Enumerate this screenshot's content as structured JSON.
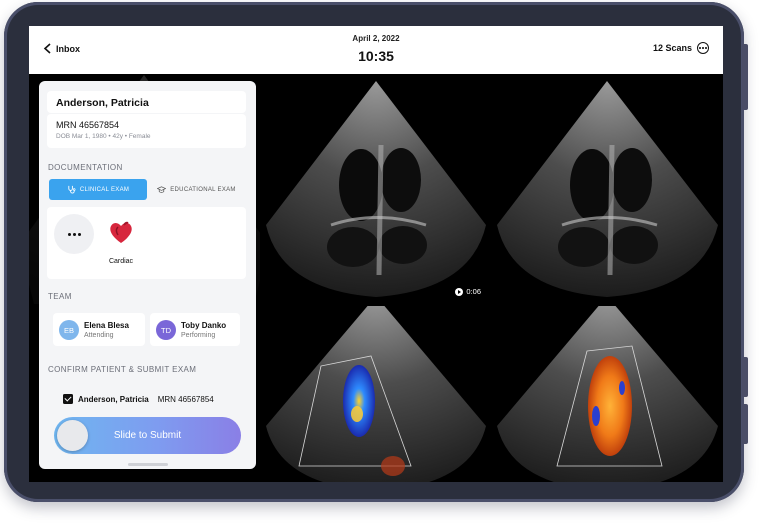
{
  "header": {
    "back_label": "Inbox",
    "date": "April 2, 2022",
    "time": "10:35",
    "scans_label": "12 Scans"
  },
  "patient": {
    "name": "Anderson, Patricia",
    "mrn": "MRN 46567854",
    "details": "DOB Mar 1, 1980  •  42y  •  Female"
  },
  "documentation": {
    "section_title": "DOCUMENTATION",
    "tabs": [
      {
        "label": "CLINICAL EXAM",
        "icon": "stethoscope-icon",
        "active": true
      },
      {
        "label": "EDUCATIONAL EXAM",
        "icon": "graduation-cap-icon",
        "active": false
      }
    ],
    "exam_types": [
      {
        "label": "Cardiac",
        "icon": "heart-icon"
      }
    ]
  },
  "team": {
    "section_title": "TEAM",
    "members": [
      {
        "initials": "EB",
        "name": "Elena Blesa",
        "role": "Attending",
        "color": "#7fb6ec"
      },
      {
        "initials": "TD",
        "name": "Toby Danko",
        "role": "Performing",
        "color": "#7a67d8"
      }
    ]
  },
  "confirm": {
    "section_title": "CONFIRM PATIENT & SUBMIT EXAM",
    "patient_name": "Anderson, Patricia",
    "patient_mrn": "MRN 46567854",
    "checked": true,
    "submit_label": "Slide to Submit"
  },
  "scans": [
    {
      "type": "echo",
      "duration": ""
    },
    {
      "type": "echo",
      "duration": "0:06"
    },
    {
      "type": "echo",
      "duration": ""
    },
    {
      "type": "color-doppler",
      "duration": ""
    },
    {
      "type": "color-doppler",
      "duration": ""
    }
  ],
  "colors": {
    "accent": "#3aa3ee",
    "slider_start": "#6fb6f0",
    "slider_end": "#8a7fe6",
    "frame": "#2b2f3d"
  }
}
